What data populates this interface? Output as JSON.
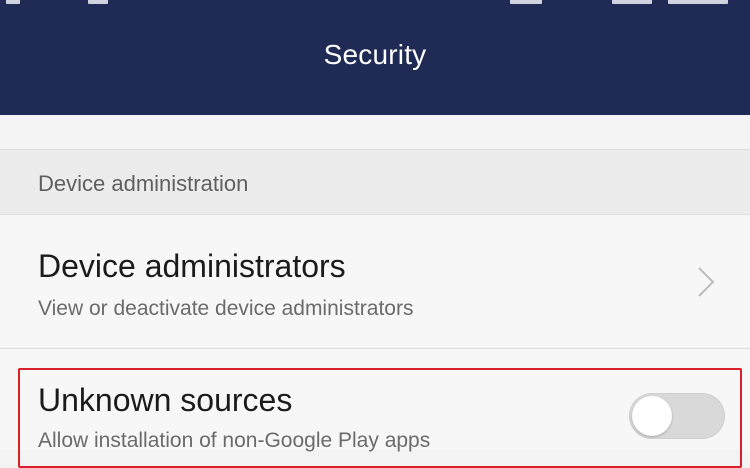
{
  "header": {
    "title": "Security"
  },
  "sections": {
    "device_administration": {
      "label": "Device administration"
    }
  },
  "rows": {
    "device_administrators": {
      "title": "Device administrators",
      "subtitle": "View or deactivate device administrators",
      "icon": "chevron-right-icon"
    },
    "unknown_sources": {
      "title": "Unknown sources",
      "subtitle": "Allow installation of non-Google Play apps",
      "toggle_on": false
    }
  },
  "colors": {
    "app_bar": "#1f2b55",
    "highlight": "#d9202a"
  }
}
